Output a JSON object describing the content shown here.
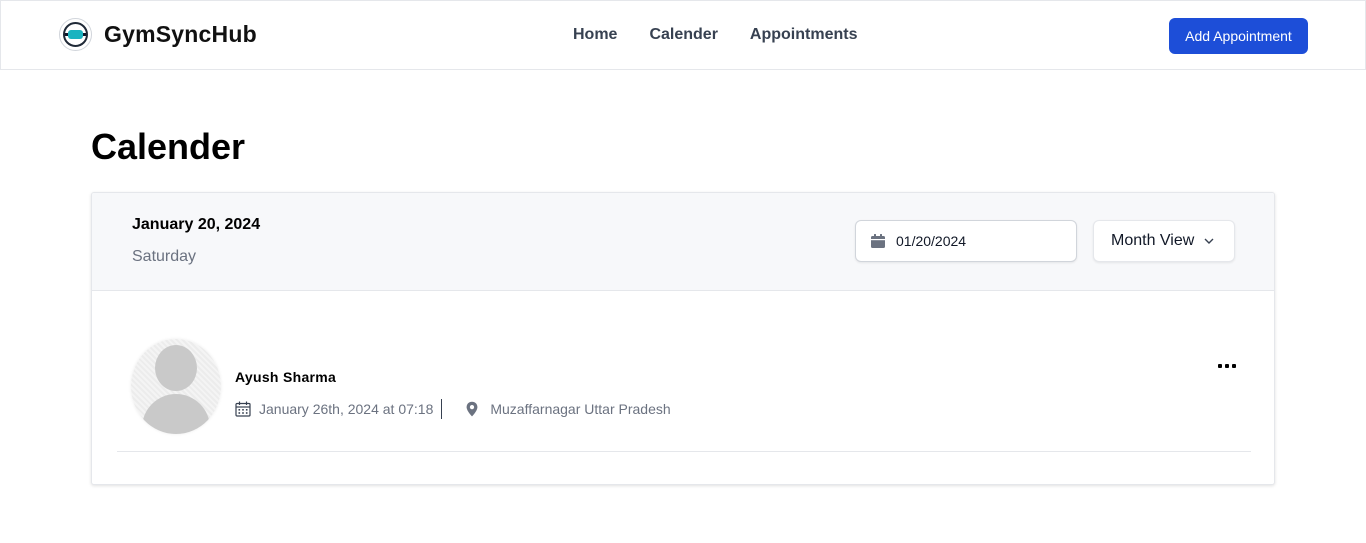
{
  "brand": {
    "name": "GymSyncHub",
    "logo_icon": "gym-logo-icon"
  },
  "nav": {
    "links": [
      "Home",
      "Calender",
      "Appointments"
    ]
  },
  "header": {
    "add_button_label": "Add Appointment",
    "accent_color": "#1d4ed8"
  },
  "page": {
    "title": "Calender"
  },
  "calendar": {
    "selected_date": "January 20, 2024",
    "selected_weekday": "Saturday",
    "date_input_value": "01/20/2024",
    "view_select_value": "Month View"
  },
  "appointments": [
    {
      "name": "Ayush Sharma",
      "datetime": "January 26th, 2024 at 07:18",
      "location": "Muzaffarnagar Uttar Pradesh"
    }
  ],
  "icons": {
    "date_input": "calendar-icon",
    "view_select": "chevron-down-icon",
    "appt_datetime": "calendar-grid-icon",
    "appt_location": "map-pin-icon",
    "appt_menu": "more-horizontal-icon"
  }
}
